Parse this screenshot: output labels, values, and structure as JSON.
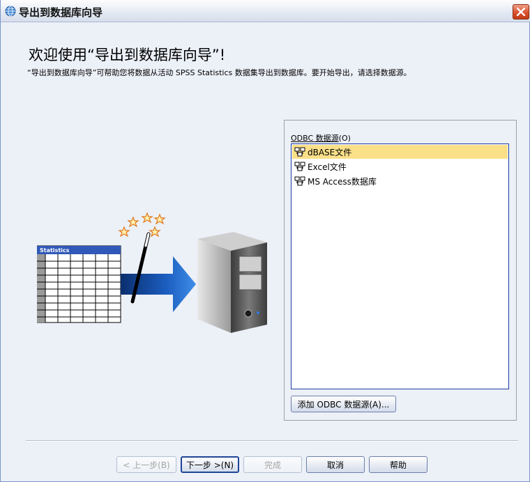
{
  "window": {
    "title": "导出到数据库向导"
  },
  "header": {
    "heading": "欢迎使用“导出到数据库向导”!",
    "description": "“导出到数据库向导”可帮助您将数据从活动 SPSS Statistics 数据集导出到数据库。要开始导出，请选择数据源。"
  },
  "illustration": {
    "table_label": "Statistics"
  },
  "odbc": {
    "group_label_prefix": "ODBC 数据源",
    "group_label_key": "(O)",
    "sources": [
      {
        "label": "dBASE文件",
        "selected": true
      },
      {
        "label": "Excel文件",
        "selected": false
      },
      {
        "label": "MS Access数据库",
        "selected": false
      }
    ],
    "add_button": "添加 ODBC 数据源(A)..."
  },
  "footer": {
    "back_button": "< 上一步(B)",
    "next_button": "下一步 >(N)",
    "finish_button": "完成",
    "cancel_button": "取消",
    "help_button": "帮助"
  },
  "colors": {
    "selection": "#fbe08a",
    "close_button": "#d9512e",
    "list_border": "#1c3aa8",
    "arrow": "#1f6fd0"
  }
}
